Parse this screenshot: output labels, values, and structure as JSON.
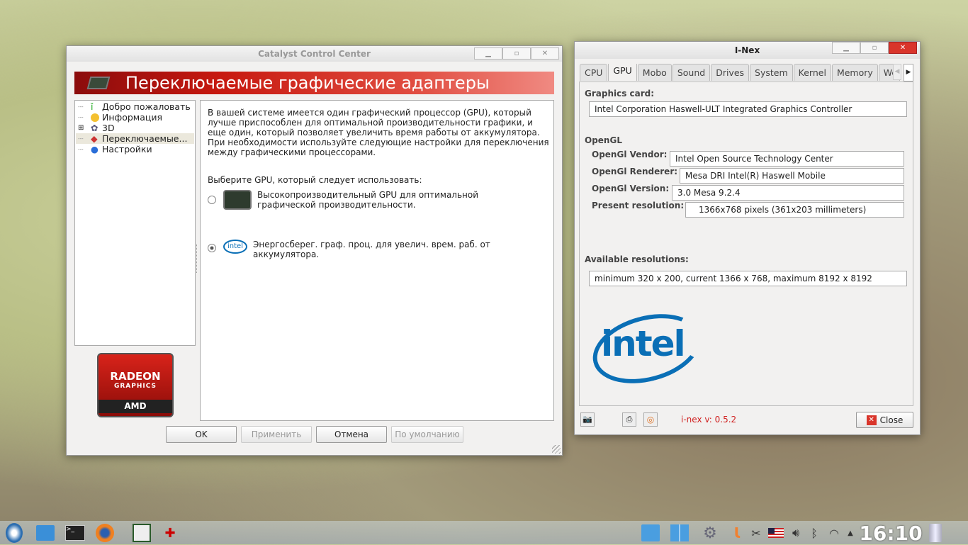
{
  "ccc": {
    "title": "Catalyst Control Center",
    "banner": "Переключаемые графические адаптеры",
    "tree": [
      {
        "label": "Добро пожаловать"
      },
      {
        "label": "Информация"
      },
      {
        "label": "3D"
      },
      {
        "label": "Переключаемые..."
      },
      {
        "label": "Настройки"
      }
    ],
    "description": "В вашей системе имеется один графический процессор (GPU), который лучше приспособлен для оптимальной производительности графики, и еще один, который позволяет увеличить время работы от аккумулятора. При необходимости используйте следующие настройки для переключения между графическими процессорами.",
    "choose_label": "Выберите GPU, который следует использовать:",
    "options": [
      {
        "label": "Высокопроизводительный GPU для оптимальной графической производительности.",
        "selected": false
      },
      {
        "label": "Энергосберег. граф. проц. для увелич. врем. раб. от аккумулятора.",
        "selected": true
      }
    ],
    "logo": {
      "line1": "RADEON",
      "line2": "GRAPHICS",
      "line3": "AMD"
    },
    "buttons": {
      "ok": "OK",
      "apply": "Применить",
      "cancel": "Отмена",
      "defaults": "По умолчанию"
    }
  },
  "inex": {
    "title": "I-Nex",
    "tabs": [
      "CPU",
      "GPU",
      "Mobo",
      "Sound",
      "Drives",
      "System",
      "Kernel",
      "Memory",
      "Wel"
    ],
    "active_tab": "GPU",
    "graphics_card_label": "Graphics card:",
    "graphics_card": "Intel Corporation Haswell-ULT Integrated Graphics Controller",
    "opengl_label": "OpenGL",
    "vendor_label": "OpenGl Vendor:",
    "vendor": "Intel Open Source Technology Center",
    "renderer_label": "OpenGl Renderer:",
    "renderer": "Mesa DRI Intel(R) Haswell Mobile",
    "version_label": "OpenGl Version:",
    "version": "3.0 Mesa 9.2.4",
    "resolution_label": "Present resolution:",
    "resolution": "1366x768 pixels (361x203 millimeters)",
    "available_label": "Available resolutions:",
    "available": "minimum 320 x 200, current 1366 x 768, maximum 8192 x 8192",
    "logo": "intel",
    "version_text": "i-nex v: 0.5.2",
    "close": "Close"
  },
  "taskbar": {
    "clock": "16:10",
    "intel_small": "intel"
  }
}
